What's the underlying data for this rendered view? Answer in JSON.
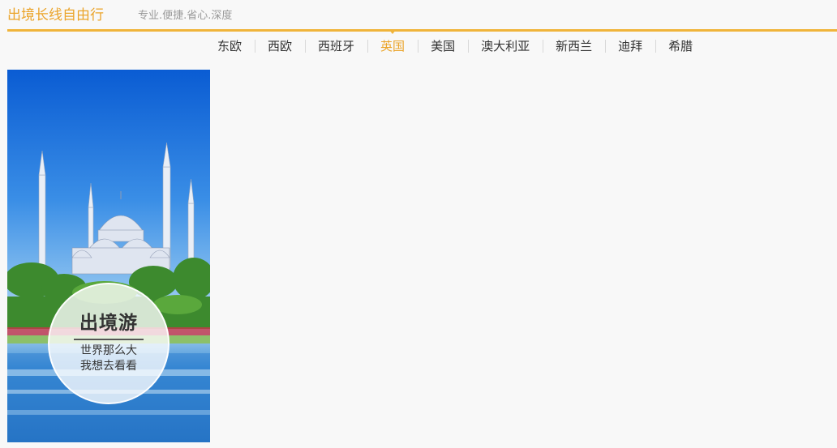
{
  "header": {
    "brand": "出境长线自由行",
    "tagline": "专业.便捷.省心.深度",
    "accent_color": "#f0b43a"
  },
  "nav": {
    "items": [
      {
        "label": "东欧"
      },
      {
        "label": "西欧"
      },
      {
        "label": "西班牙"
      },
      {
        "label": "英国"
      },
      {
        "label": "美国"
      },
      {
        "label": "澳大利亚"
      },
      {
        "label": "新西兰"
      },
      {
        "label": "迪拜"
      },
      {
        "label": "希腊"
      }
    ],
    "active": "英国"
  },
  "banner": {
    "title": "出境游",
    "line1": "世界那么大",
    "line2": "我想去看看"
  }
}
